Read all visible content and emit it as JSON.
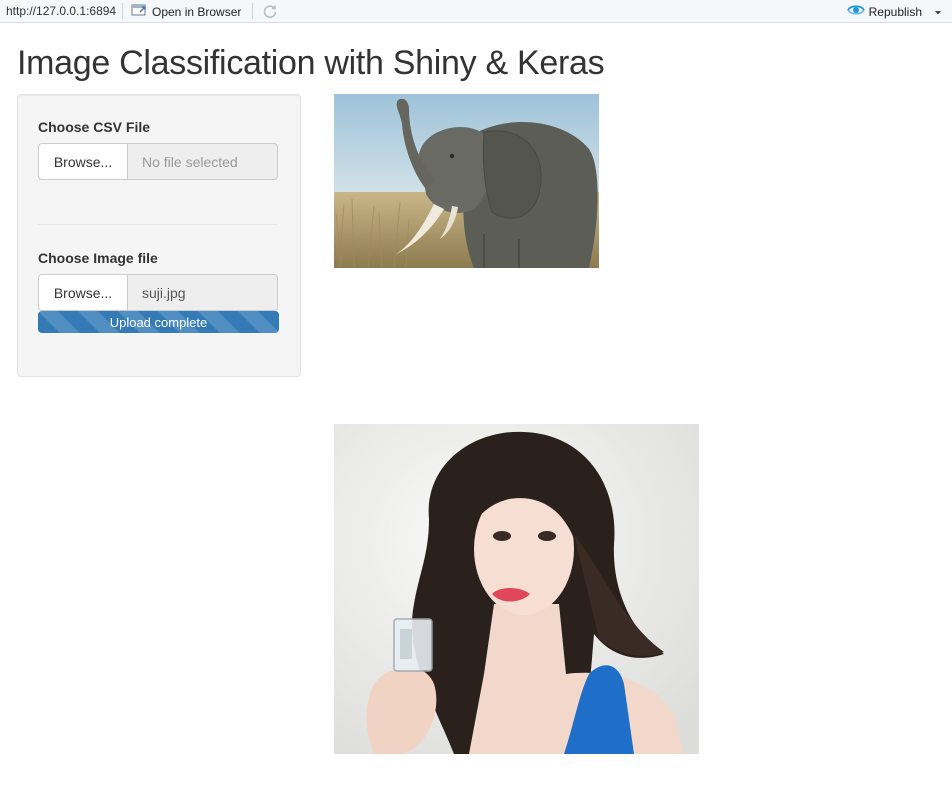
{
  "toolbar": {
    "url": "http://127.0.0.1:6894",
    "open_in_browser": "Open in Browser",
    "republish": "Republish"
  },
  "page": {
    "title": "Image Classification with Shiny & Keras"
  },
  "sidebar": {
    "csv": {
      "label": "Choose CSV File",
      "browse_label": "Browse...",
      "filename": "No file selected"
    },
    "image": {
      "label": "Choose Image file",
      "browse_label": "Browse...",
      "filename": "suji.jpg",
      "progress_text": "Upload complete",
      "progress": 1.0
    }
  },
  "colors": {
    "accent": "#337ab7",
    "republish_icon": "#1a9ad6"
  },
  "icons": {
    "open_in_browser": "browser-window-icon",
    "refresh": "refresh-icon",
    "republish": "publish-icon",
    "dropdown": "caret-down-icon"
  }
}
